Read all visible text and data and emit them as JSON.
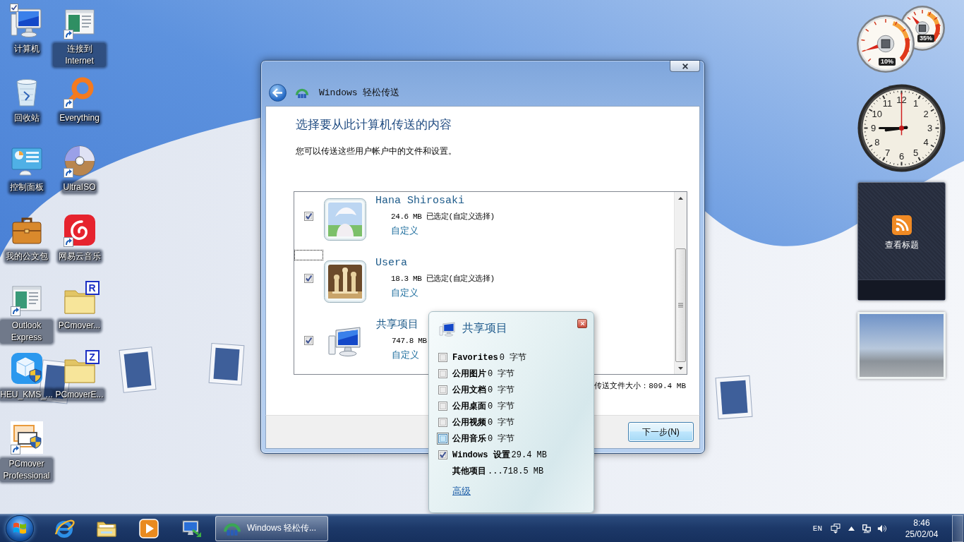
{
  "desktop_icons": [
    {
      "label": "计算机",
      "kind": "computer",
      "shortcut": false,
      "checked": true
    },
    {
      "label": "回收站",
      "kind": "bin",
      "shortcut": false,
      "checked": false
    },
    {
      "label": "控制面板",
      "kind": "panel",
      "shortcut": false,
      "checked": false
    },
    {
      "label": "我的公文包",
      "kind": "briefcase",
      "shortcut": false,
      "checked": false
    },
    {
      "label": "Outlook Express",
      "kind": "mailwindow",
      "shortcut": true,
      "checked": false
    },
    {
      "label": "HEU_KMS_...",
      "kind": "cube",
      "shortcut": false,
      "checked": false
    },
    {
      "label": "PCmover Professional",
      "kind": "installer",
      "shortcut": true,
      "checked": false
    },
    {
      "label": "连接到 Internet",
      "kind": "webpage",
      "shortcut": true,
      "checked": false
    },
    {
      "label": "Everything",
      "kind": "ring",
      "shortcut": true,
      "checked": false
    },
    {
      "label": "UltraISO",
      "kind": "disc",
      "shortcut": true,
      "checked": false
    },
    {
      "label": "网易云音乐",
      "kind": "swirl",
      "shortcut": true,
      "checked": false
    },
    {
      "label": "PCmover...",
      "kind": "folder",
      "badge": "R",
      "shortcut": false,
      "checked": false
    },
    {
      "label": "PCmoverE...",
      "kind": "folder",
      "badge": "Z",
      "shortcut": false,
      "checked": false
    }
  ],
  "dialog": {
    "title": "Windows 轻松传送",
    "heading": "选择要从此计算机传送的内容",
    "description": "您可以传送这些用户帐户中的文件和设置。",
    "accounts": [
      {
        "kind": "anime",
        "name": "Hana Shirosaki",
        "size": "24.6 MB 已选定(自定义选择)",
        "link": "自定义",
        "checked": true
      },
      {
        "kind": "chess",
        "name": "Usera",
        "size": "18.3 MB 已选定(自定义选择)",
        "link": "自定义",
        "checked": true
      },
      {
        "kind": "computer",
        "name": "共享项目",
        "size": "747.8 MB",
        "link": "自定义",
        "checked": true
      }
    ],
    "total": "传送文件大小：809.4 MB",
    "next_button": "下一步(N)"
  },
  "popup": {
    "title": "共享项目",
    "items": [
      {
        "kind": "checkbox",
        "name": "Favorites",
        "size": "0 字节",
        "checked": false,
        "focused": false
      },
      {
        "kind": "checkbox",
        "name": "公用图片",
        "size": "0 字节",
        "checked": false,
        "focused": false
      },
      {
        "kind": "checkbox",
        "name": "公用文档",
        "size": "0 字节",
        "checked": false,
        "focused": false
      },
      {
        "kind": "checkbox",
        "name": "公用桌面",
        "size": "0 字节",
        "checked": false,
        "focused": false
      },
      {
        "kind": "checkbox",
        "name": "公用视频",
        "size": "0 字节",
        "checked": false,
        "focused": false
      },
      {
        "kind": "checkbox",
        "name": "公用音乐",
        "size": "0 字节",
        "checked": false,
        "focused": true
      },
      {
        "kind": "checkbox",
        "name": "Windows 设置",
        "size": "29.4 MB",
        "checked": true,
        "focused": false
      },
      {
        "kind": "plain",
        "name": "其他项目",
        "size": "...718.5 MB"
      }
    ],
    "link": "高级"
  },
  "gadgets": {
    "cpu_meter": [
      {
        "label": "10%",
        "level": 0.1
      },
      {
        "label": "35%",
        "level": 0.35
      }
    ],
    "clock": {
      "numerals": [
        "12",
        "11",
        "1",
        "10",
        "2",
        "9",
        "3",
        "8",
        "4",
        "7",
        "5",
        "6"
      ]
    },
    "feed": {
      "label": "查看标题"
    }
  },
  "taskbar": {
    "task": {
      "label": "Windows 轻松传...",
      "selected": true
    },
    "tray": {
      "language": "EN",
      "time": "8:46",
      "date": "25/02/04"
    }
  }
}
